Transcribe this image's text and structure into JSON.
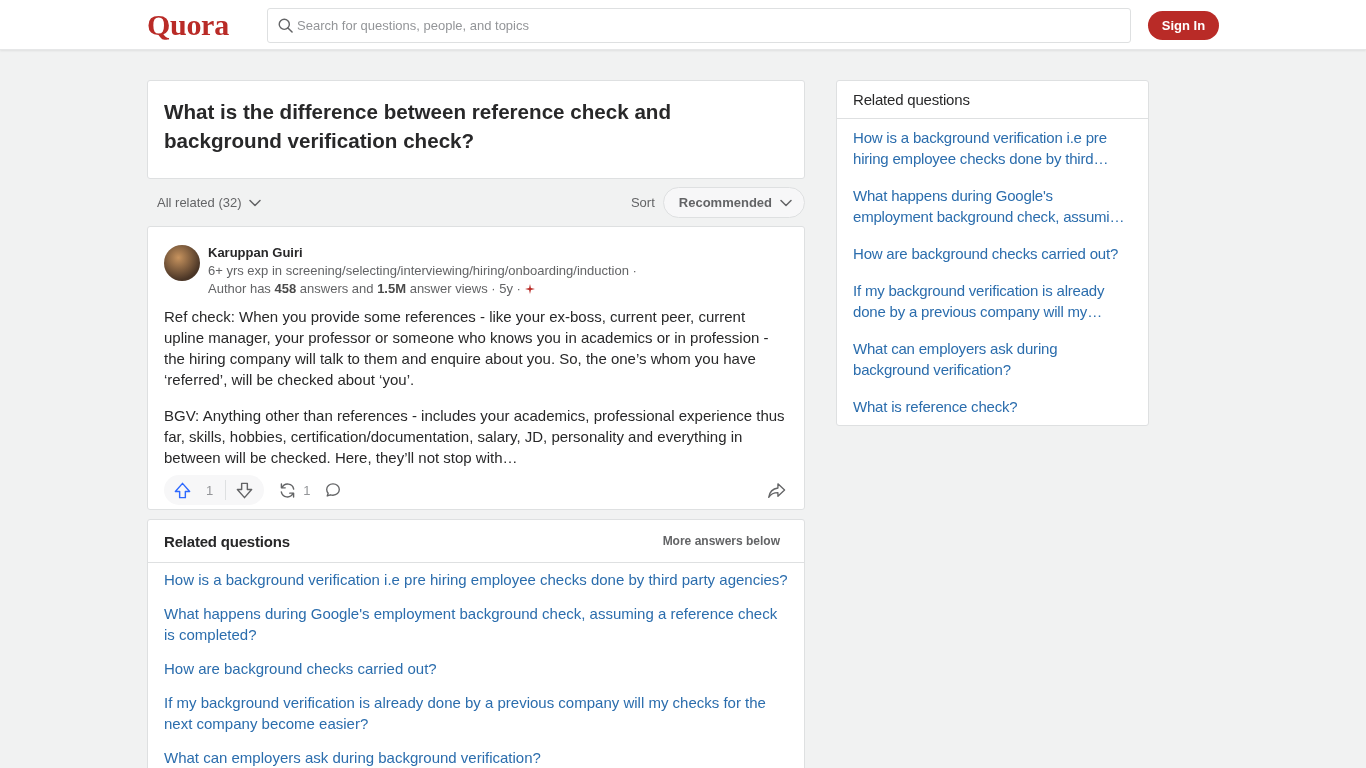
{
  "header": {
    "logo": "Quora",
    "search": {
      "placeholder": "Search for questions, people, and topics"
    },
    "sign_in": "Sign In"
  },
  "question": {
    "title": "What is the difference between reference check and background verification check?"
  },
  "filter": {
    "all_related": "All related (32)",
    "sort_label": "Sort",
    "sort_value": "Recommended"
  },
  "answer": {
    "author": "Karuppan Guiri",
    "credential": "6+ yrs exp in screening/selecting/interviewing/hiring/onboarding/induction ·",
    "stats": "Author has **458** answers and **1.5M** answer views ·",
    "time": "5y ·",
    "paragraphs": [
      "Ref check: When you provide some references - like your ex-boss, current peer, current upline manager, your professor or someone who knows you in academics or in profession - the hiring company will talk to them and enquire about you. So, the one’s whom you have ‘referred’, will be checked about ‘you’.",
      "BGV: Anything other than references - includes your academics, professional experience thus far, skills, hobbies, certification/documentation, salary, JD, personality and everything in between will be checked. Here, they’ll not stop with…"
    ],
    "upvotes": "1",
    "reshares": "1"
  },
  "related": {
    "title": "Related questions",
    "more": "More answers below",
    "items": [
      "How is a background verification i.e pre hiring employee checks done by third party agencies?",
      "What happens during Google's employment background check, assuming a reference check is completed?",
      "How are background checks carried out?",
      "If my background verification is already done by a previous company will my checks for the next company become easier?",
      "What can employers ask during background verification?"
    ]
  },
  "sidebar": {
    "title": "Related questions",
    "items": [
      "How is a background verification i.e pre hiring employee checks done by third…",
      "What happens during Google's employment background check, assumi…",
      "How are background checks carried out?",
      "If my background verification is already done by a previous company will my…",
      "What can employers ask during background verification?",
      "What is reference check?"
    ]
  }
}
